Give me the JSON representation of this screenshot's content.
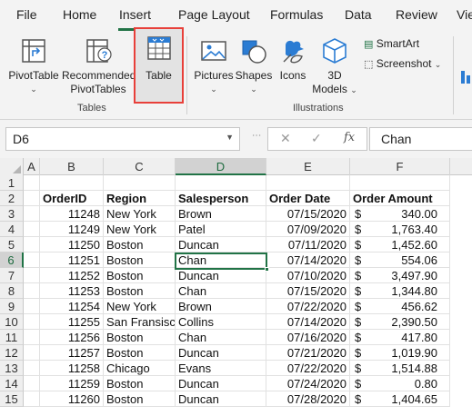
{
  "tabs": [
    "File",
    "Home",
    "Insert",
    "Page Layout",
    "Formulas",
    "Data",
    "Review",
    "Vie"
  ],
  "ribbon": {
    "pivottable": "PivotTable",
    "recommended_line1": "Recommended",
    "recommended_line2": "PivotTables",
    "table": "Table",
    "pictures": "Pictures",
    "shapes": "Shapes",
    "icons": "Icons",
    "models_line1": "3D",
    "models_line2": "Models",
    "smartart": "SmartArt",
    "screenshot": "Screenshot",
    "group_tables": "Tables",
    "group_illustrations": "Illustrations"
  },
  "formula_bar": {
    "name_box": "D6",
    "cancel": "✕",
    "enter": "✓",
    "fx": "fx",
    "value": "Chan"
  },
  "grid": {
    "columns": [
      "A",
      "B",
      "C",
      "D",
      "E",
      "F"
    ],
    "selected_column": "D",
    "selected_row": "6",
    "rows": [
      "1",
      "2",
      "3",
      "4",
      "5",
      "6",
      "7",
      "8",
      "9",
      "10",
      "11",
      "12",
      "13",
      "14",
      "15"
    ],
    "headers": [
      "OrderID",
      "Region",
      "Salesperson",
      "Order Date",
      "Order Amount"
    ],
    "data": [
      [
        "11248",
        "New York",
        "Brown",
        "07/15/2020",
        "$",
        "340.00"
      ],
      [
        "11249",
        "New York",
        "Patel",
        "07/09/2020",
        "$",
        "1,763.40"
      ],
      [
        "11250",
        "Boston",
        "Duncan",
        "07/11/2020",
        "$",
        "1,452.60"
      ],
      [
        "11251",
        "Boston",
        "Chan",
        "07/14/2020",
        "$",
        "554.06"
      ],
      [
        "11252",
        "Boston",
        "Duncan",
        "07/10/2020",
        "$",
        "3,497.90"
      ],
      [
        "11253",
        "Boston",
        "Chan",
        "07/15/2020",
        "$",
        "1,344.80"
      ],
      [
        "11254",
        "New York",
        "Brown",
        "07/22/2020",
        "$",
        "456.62"
      ],
      [
        "11255",
        "San Fransisc",
        "Collins",
        "07/14/2020",
        "$",
        "2,390.50"
      ],
      [
        "11256",
        "Boston",
        "Chan",
        "07/16/2020",
        "$",
        "417.80"
      ],
      [
        "11257",
        "Boston",
        "Duncan",
        "07/21/2020",
        "$",
        "1,019.90"
      ],
      [
        "11258",
        "Chicago",
        "Evans",
        "07/22/2020",
        "$",
        "1,514.88"
      ],
      [
        "11259",
        "Boston",
        "Duncan",
        "07/24/2020",
        "$",
        "0.80"
      ],
      [
        "11260",
        "Boston",
        "Duncan",
        "07/28/2020",
        "$",
        "1,404.65"
      ]
    ]
  },
  "colors": {
    "accent": "#217346",
    "highlight": "#e8403a"
  }
}
